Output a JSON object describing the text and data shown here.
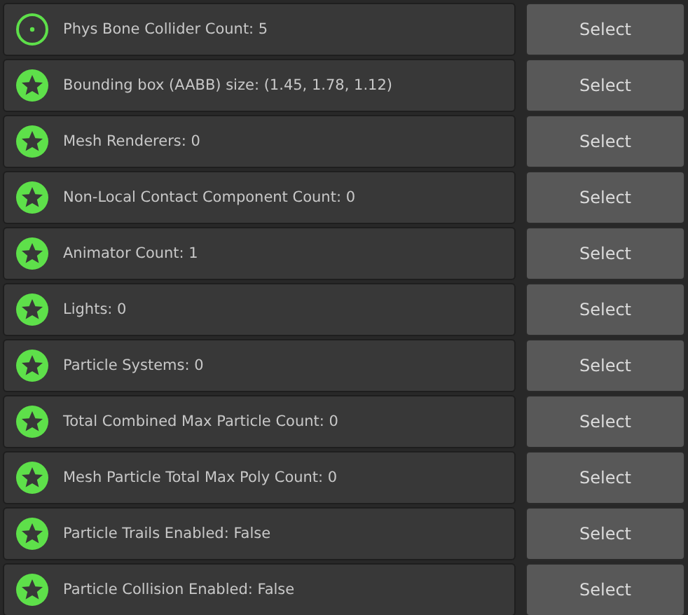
{
  "rows": [
    {
      "kind": "ring",
      "label": "Phys Bone Collider Count: 5",
      "button": "Select"
    },
    {
      "kind": "star",
      "label": "Bounding box (AABB) size: (1.45, 1.78, 1.12)",
      "button": "Select"
    },
    {
      "kind": "star",
      "label": "Mesh Renderers: 0",
      "button": "Select"
    },
    {
      "kind": "star",
      "label": "Non-Local Contact Component Count: 0",
      "button": "Select"
    },
    {
      "kind": "star",
      "label": "Animator Count: 1",
      "button": "Select"
    },
    {
      "kind": "star",
      "label": "Lights: 0",
      "button": "Select"
    },
    {
      "kind": "star",
      "label": "Particle Systems: 0",
      "button": "Select"
    },
    {
      "kind": "star",
      "label": "Total Combined Max Particle Count: 0",
      "button": "Select"
    },
    {
      "kind": "star",
      "label": "Mesh Particle Total Max Poly Count: 0",
      "button": "Select"
    },
    {
      "kind": "star",
      "label": "Particle Trails Enabled: False",
      "button": "Select"
    },
    {
      "kind": "star",
      "label": "Particle Collision Enabled: False",
      "button": "Select"
    }
  ]
}
